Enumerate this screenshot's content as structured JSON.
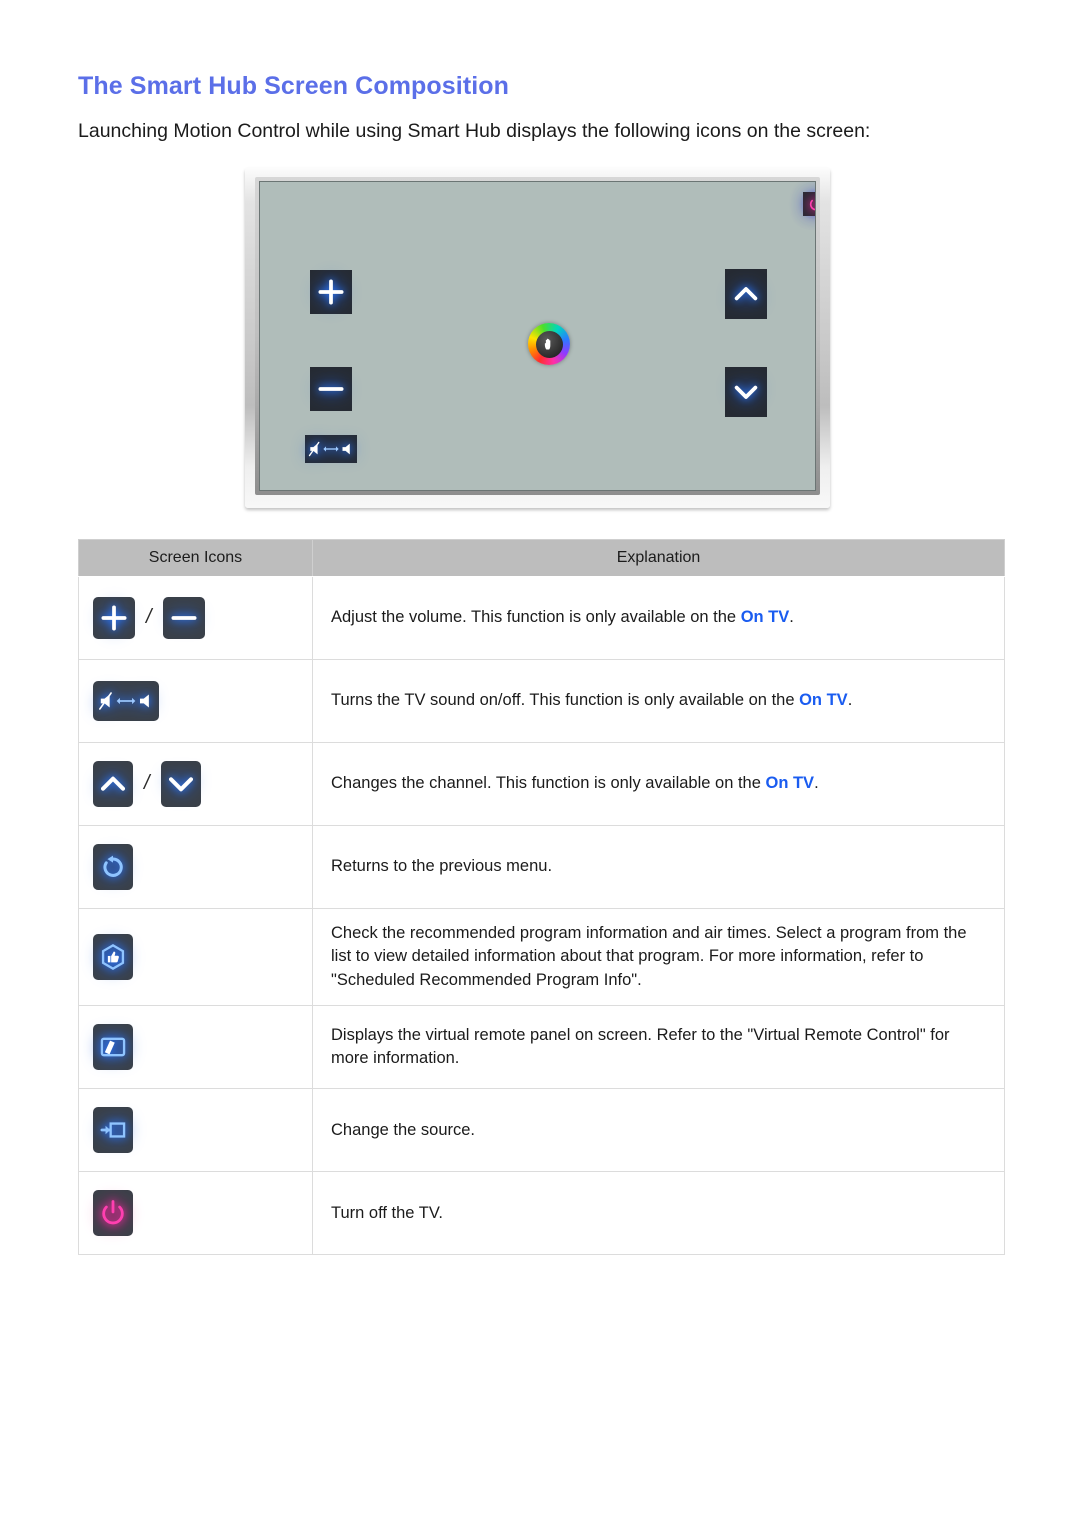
{
  "document": {
    "title": "The Smart Hub Screen Composition",
    "intro": "Launching Motion Control while using Smart Hub displays the following icons on the screen:"
  },
  "colors": {
    "heading": "#5b6fe8",
    "link": "#1a5cf0",
    "icon_glow_blue": "#2e7bff",
    "icon_glow_pink": "#ff2ea8",
    "icon_tile": "#3a4048",
    "screen_tile": "#262b33",
    "tv_screen": "#b0bdba",
    "table_header": "#bdbdbd"
  },
  "tv_illustration": {
    "name": "smart-hub-motion-control-screen",
    "top_icons": [
      {
        "name": "return-icon",
        "label": "Return"
      },
      {
        "name": "recommended-program-icon",
        "label": "Recommended"
      },
      {
        "name": "virtual-remote-icon",
        "label": "Virtual Remote Control"
      },
      {
        "name": "source-icon",
        "label": "Source"
      },
      {
        "name": "power-icon",
        "label": "Power Off"
      }
    ],
    "left_icons": [
      {
        "name": "volume-up-icon",
        "label": "Volume Up"
      },
      {
        "name": "volume-down-icon",
        "label": "Volume Down"
      },
      {
        "name": "mute-toggle-icon",
        "label": "Mute / Unmute"
      }
    ],
    "right_icons": [
      {
        "name": "channel-up-icon",
        "label": "Channel Up"
      },
      {
        "name": "channel-down-icon",
        "label": "Channel Down"
      }
    ],
    "cursor": {
      "name": "hand-cursor",
      "label": "Motion Control hand cursor"
    }
  },
  "table": {
    "headers": [
      "Screen Icons",
      "Explanation"
    ],
    "rows": [
      {
        "icons": [
          "volume-up-icon",
          "volume-down-icon"
        ],
        "separator": "/",
        "text_before": "Adjust the volume. This function is only available on the ",
        "link": "On TV",
        "text_after": "."
      },
      {
        "icons": [
          "mute-toggle-icon"
        ],
        "separator": "",
        "text_before": "Turns the TV sound on/off. This function is only available on the ",
        "link": "On TV",
        "text_after": "."
      },
      {
        "icons": [
          "channel-up-icon",
          "channel-down-icon"
        ],
        "separator": "/",
        "text_before": "Changes the channel. This function is only available on the ",
        "link": "On TV",
        "text_after": "."
      },
      {
        "icons": [
          "return-icon"
        ],
        "separator": "",
        "text_before": "Returns to the previous menu.",
        "link": "",
        "text_after": ""
      },
      {
        "icons": [
          "recommended-program-icon"
        ],
        "separator": "",
        "text_before": "Check the recommended program information and air times. Select a program from the list to view detailed information about that program. For more information, refer to \"Scheduled Recommended Program Info\".",
        "link": "",
        "text_after": ""
      },
      {
        "icons": [
          "virtual-remote-icon"
        ],
        "separator": "",
        "text_before": "Displays the virtual remote panel on screen. Refer to the \"Virtual Remote Control\" for more information.",
        "link": "",
        "text_after": ""
      },
      {
        "icons": [
          "source-icon"
        ],
        "separator": "",
        "text_before": "Change the source.",
        "link": "",
        "text_after": ""
      },
      {
        "icons": [
          "power-icon"
        ],
        "separator": "",
        "text_before": "Turn off the TV.",
        "link": "",
        "text_after": ""
      }
    ]
  }
}
